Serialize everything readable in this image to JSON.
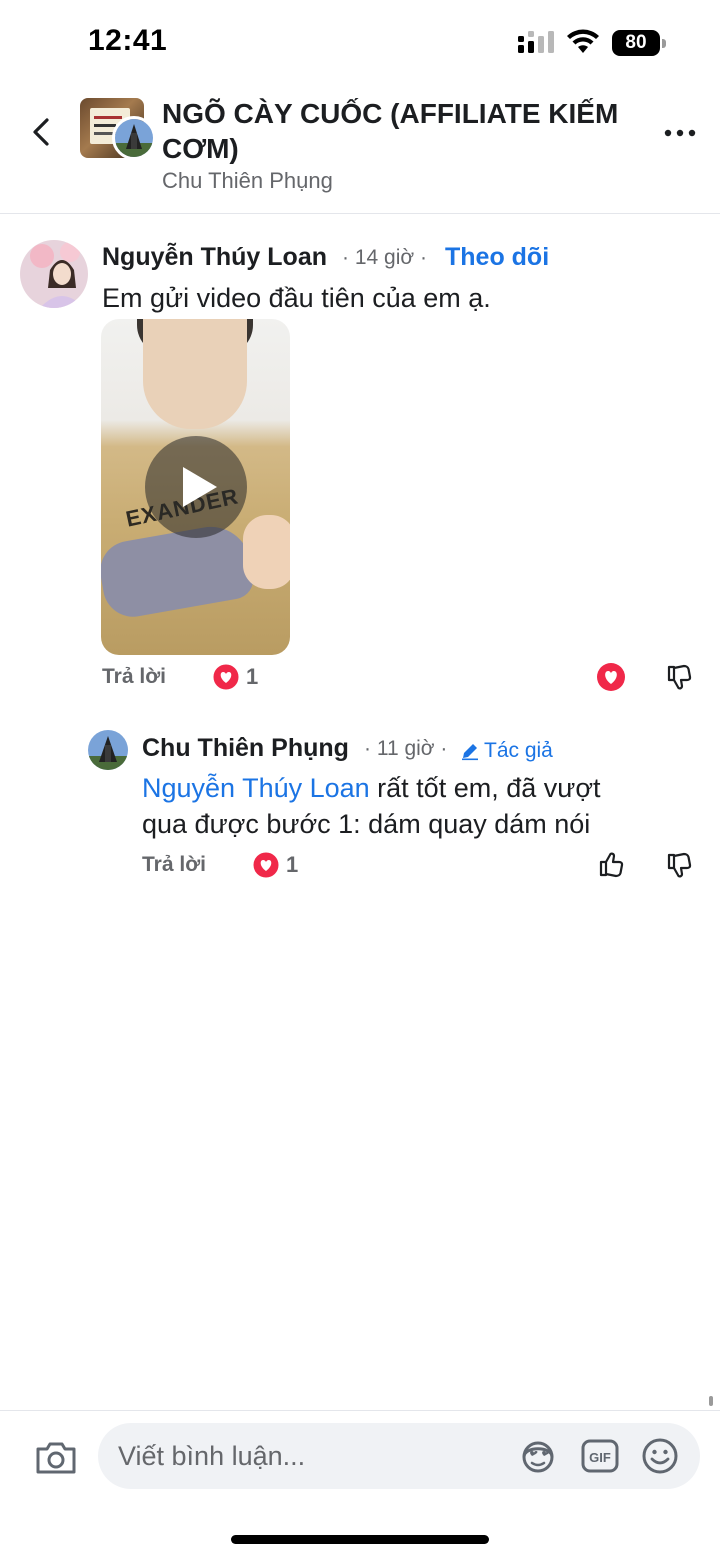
{
  "status_bar": {
    "time": "12:41",
    "battery": "80"
  },
  "header": {
    "title": "NGÕ CÀY CUỐC (AFFILIATE KIẾM CƠM)",
    "subtitle": "Chu Thiên Phụng"
  },
  "comments": [
    {
      "author": "Nguyễn Thúy Loan",
      "meta": "· 14 giờ ·",
      "follow_label": "Theo dõi",
      "text": "Em gửi video đầu tiên của em ạ.",
      "has_video": true,
      "reply_label": "Trả lời",
      "reaction_count": "1"
    }
  ],
  "replies": [
    {
      "author": "Chu Thiên Phụng",
      "meta": "· 11 giờ ·",
      "badge": "Tác giả",
      "mention": "Nguyễn Thúy Loan",
      "text_line1": " rất tốt em, đã vượt",
      "text_line2": "qua được bước 1: dám quay dám nói",
      "reply_label": "Trả lời",
      "reaction_count": "1"
    }
  ],
  "video_shirt_text": "EXANDER",
  "composer": {
    "placeholder": "Viết bình luận..."
  },
  "colors": {
    "link_blue": "#1b74e4",
    "heart_red": "#f02849",
    "secondary_text": "#65676b",
    "input_bg": "#f0f2f5"
  },
  "icons": [
    "back-arrow-icon",
    "more-icon",
    "heart-icon",
    "dislike-icon",
    "like-icon",
    "pencil-icon",
    "camera-icon",
    "avatar-sticker-icon",
    "gif-icon",
    "emoji-icon",
    "play-icon",
    "wifi-icon",
    "signal-icon",
    "battery-icon"
  ]
}
